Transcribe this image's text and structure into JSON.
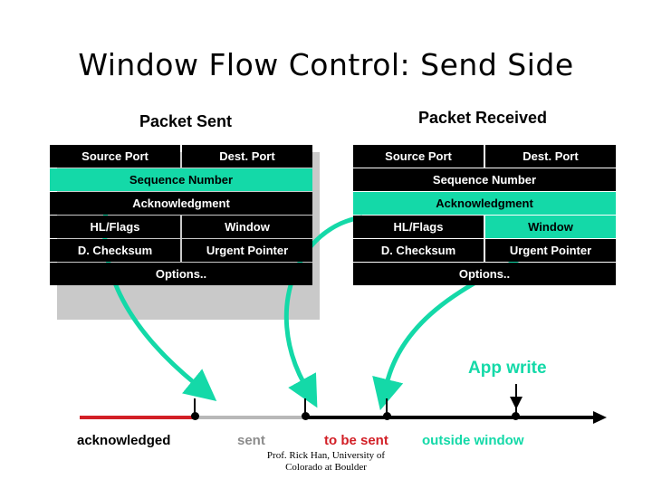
{
  "title": "Window Flow Control: Send Side",
  "panels": {
    "sent": {
      "label": "Packet Sent",
      "rows": [
        {
          "cells": [
            {
              "text": "Source Port",
              "style": "black"
            },
            {
              "text": "Dest. Port",
              "style": "black"
            }
          ]
        },
        {
          "cells": [
            {
              "text": "Sequence Number",
              "style": "teal"
            }
          ]
        },
        {
          "cells": [
            {
              "text": "Acknowledgment",
              "style": "black"
            }
          ]
        },
        {
          "cells": [
            {
              "text": "HL/Flags",
              "style": "black"
            },
            {
              "text": "Window",
              "style": "black"
            }
          ]
        },
        {
          "cells": [
            {
              "text": "D. Checksum",
              "style": "black"
            },
            {
              "text": "Urgent Pointer",
              "style": "black"
            }
          ]
        },
        {
          "cells": [
            {
              "text": "Options..",
              "style": "black"
            }
          ]
        }
      ]
    },
    "received": {
      "label": "Packet Received",
      "rows": [
        {
          "cells": [
            {
              "text": "Source Port",
              "style": "black"
            },
            {
              "text": "Dest. Port",
              "style": "black"
            }
          ]
        },
        {
          "cells": [
            {
              "text": "Sequence Number",
              "style": "black"
            }
          ]
        },
        {
          "cells": [
            {
              "text": "Acknowledgment",
              "style": "teal"
            }
          ]
        },
        {
          "cells": [
            {
              "text": "HL/Flags",
              "style": "black"
            },
            {
              "text": "Window",
              "style": "teal"
            }
          ]
        },
        {
          "cells": [
            {
              "text": "D. Checksum",
              "style": "black"
            },
            {
              "text": "Urgent Pointer",
              "style": "black"
            }
          ]
        },
        {
          "cells": [
            {
              "text": "Options..",
              "style": "black"
            }
          ]
        }
      ]
    }
  },
  "timeline": {
    "app_write": "App write",
    "segments": [
      {
        "name": "acknowledged",
        "label": "acknowledged",
        "color": "#d21f26"
      },
      {
        "name": "sent",
        "label": "sent",
        "color": "#b8b8b8"
      },
      {
        "name": "to-be-sent",
        "label": "to be sent",
        "color": "#d21f26"
      },
      {
        "name": "outside-window",
        "label": "outside window",
        "color": "#14d9a8"
      }
    ]
  },
  "credit": {
    "line1": "Prof. Rick Han, University of",
    "line2": "Colorado at Boulder"
  },
  "colors": {
    "teal": "#14d9a8",
    "red": "#d21f26",
    "gray": "#b8b8b8",
    "black": "#000000"
  }
}
